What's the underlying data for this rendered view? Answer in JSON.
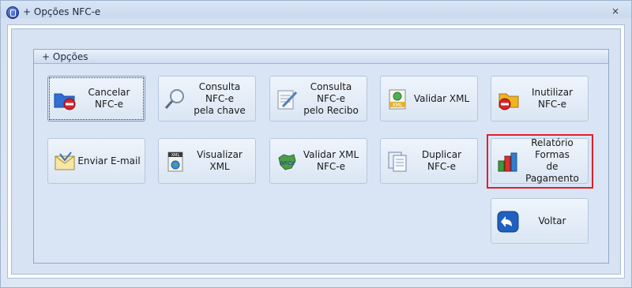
{
  "window": {
    "title": "+ Opções NFC-e",
    "close_glyph": "⨯"
  },
  "group": {
    "title": "+ Opções"
  },
  "buttons": {
    "cancelar": {
      "label": "Cancelar NFC-e",
      "icon": "folder-cancel-icon"
    },
    "consulta_chave": {
      "label": "Consulta NFC-e\npela chave",
      "icon": "magnifier-icon"
    },
    "consulta_recibo": {
      "label": "Consulta NFC-e\npelo Recibo",
      "icon": "notepad-pencil-icon"
    },
    "validar_xml": {
      "label": "Validar XML",
      "icon": "xml-document-icon"
    },
    "inutilizar": {
      "label": "Inutilizar NFC-e",
      "icon": "folder-block-icon"
    },
    "enviar_email": {
      "label": "Enviar E-mail",
      "icon": "envelope-icon"
    },
    "visualizar_xml": {
      "label": "Visualizar XML",
      "icon": "xml-globe-icon"
    },
    "validar_xml_nfce": {
      "label": "Validar XML\nNFC-e",
      "icon": "nfce-map-icon"
    },
    "duplicar": {
      "label": "Duplicar NFC-e",
      "icon": "documents-icon"
    },
    "relatorio": {
      "label": "Relatório Formas\nde Pagamento",
      "icon": "bar-chart-icon"
    },
    "voltar": {
      "label": "Voltar",
      "icon": "back-arrow-icon"
    }
  },
  "colors": {
    "highlight": "#e0202a",
    "accent": "#1f5fbf"
  }
}
